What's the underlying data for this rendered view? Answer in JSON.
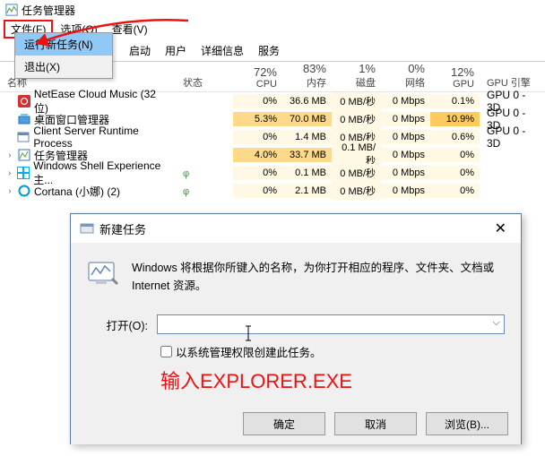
{
  "window": {
    "title": "任务管理器"
  },
  "menubar": {
    "file": "文件(F)",
    "options": "选项(O)",
    "view": "查看(V)"
  },
  "file_menu": {
    "new_task": "运行新任务(N)",
    "exit": "退出(X)"
  },
  "tabs": {
    "startup": "启动",
    "users": "用户",
    "details": "详细信息",
    "services": "服务"
  },
  "columns": {
    "name": "名称",
    "status": "状态",
    "cpu_h": "72%",
    "cpu": "CPU",
    "mem_h": "83%",
    "mem": "内存",
    "disk_h": "1%",
    "disk": "磁盘",
    "net_h": "0%",
    "net": "网络",
    "gpu_h": "12%",
    "gpu": "GPU",
    "engine": "GPU 引擎"
  },
  "rows": [
    {
      "name": "NetEase Cloud Music (32 位)",
      "cpu": "0%",
      "mem": "36.6 MB",
      "disk": "0 MB/秒",
      "net": "0 Mbps",
      "gpu": "0.1%",
      "engine": "GPU 0 - 3D",
      "icon": "netease"
    },
    {
      "name": "桌面窗口管理器",
      "cpu": "5.3%",
      "mem": "70.0 MB",
      "disk": "0 MB/秒",
      "net": "0 Mbps",
      "gpu": "10.9%",
      "engine": "GPU 0 - 3D",
      "icon": "dwm",
      "hot": true
    },
    {
      "name": "Client Server Runtime Process",
      "cpu": "0%",
      "mem": "1.4 MB",
      "disk": "0 MB/秒",
      "net": "0 Mbps",
      "gpu": "0.6%",
      "engine": "GPU 0 - 3D",
      "icon": "csrss"
    },
    {
      "name": "任务管理器",
      "cpu": "4.0%",
      "mem": "33.7 MB",
      "disk": "0.1 MB/秒",
      "net": "0 Mbps",
      "gpu": "0%",
      "engine": "",
      "icon": "tm",
      "expand": true,
      "hot": true
    },
    {
      "name": "Windows Shell Experience 主...",
      "cpu": "0%",
      "mem": "0.1 MB",
      "disk": "0 MB/秒",
      "net": "0 Mbps",
      "gpu": "0%",
      "engine": "",
      "icon": "shell",
      "expand": true,
      "leaf": true
    },
    {
      "name": "Cortana (小娜) (2)",
      "cpu": "0%",
      "mem": "2.1 MB",
      "disk": "0 MB/秒",
      "net": "0 Mbps",
      "gpu": "0%",
      "engine": "",
      "icon": "cortana",
      "expand": true,
      "leaf": true
    }
  ],
  "dialog": {
    "title": "新建任务",
    "message": "Windows 将根据你所键入的名称，为你打开相应的程序、文件夹、文档或 Internet 资源。",
    "open_label": "打开(O):",
    "admin_label": "以系统管理权限创建此任务。",
    "hint": "输入EXPLORER.EXE",
    "ok": "确定",
    "cancel": "取消",
    "browse": "浏览(B)..."
  }
}
